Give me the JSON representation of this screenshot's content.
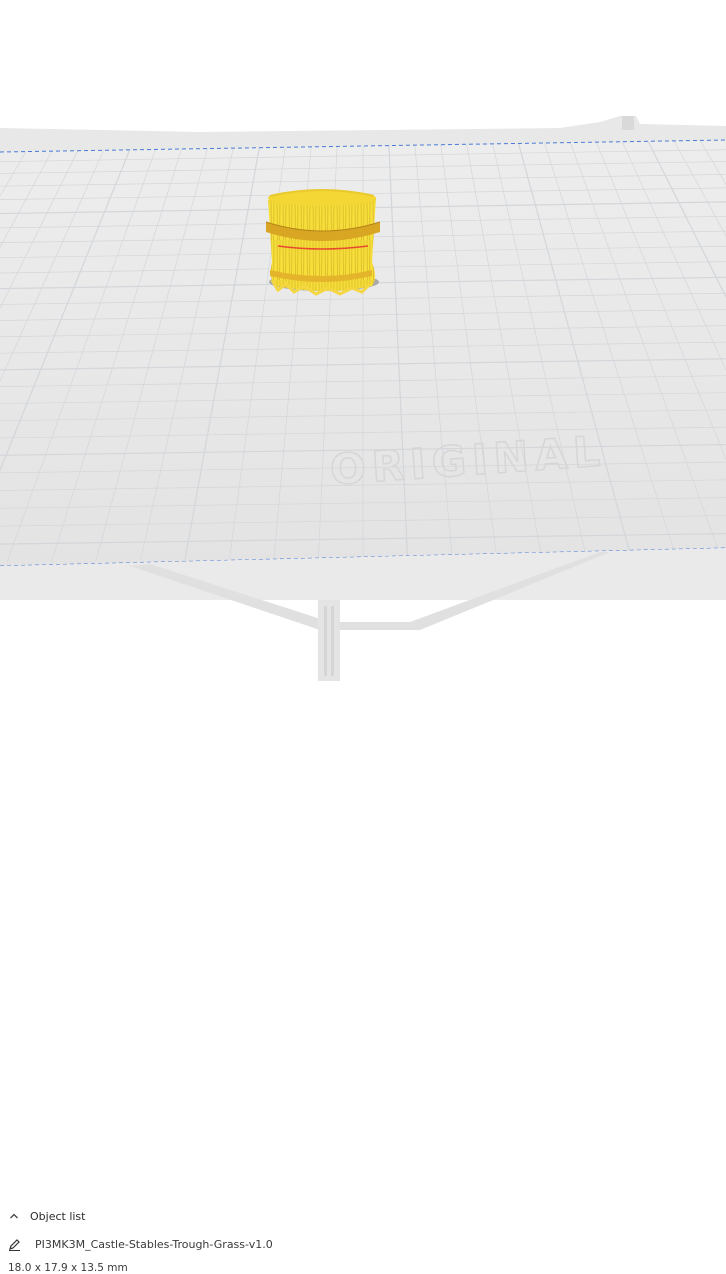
{
  "viewport": {
    "watermark": "ORIGINAL",
    "bed_color": "#ececec",
    "grid_color": "#cfd3d8",
    "model_color": "#f7df3a",
    "band_color": "#d8a820",
    "edge_line_color": "#4a7bd8"
  },
  "object_list": {
    "title": "Object list",
    "collapse_icon": "chevron-up-icon",
    "item_icon": "pencil-icon",
    "item_name": "PI3MK3M_Castle-Stables-Trough-Grass-v1.0",
    "dimensions": "18.0 x 17.9 x 13.5 mm"
  }
}
